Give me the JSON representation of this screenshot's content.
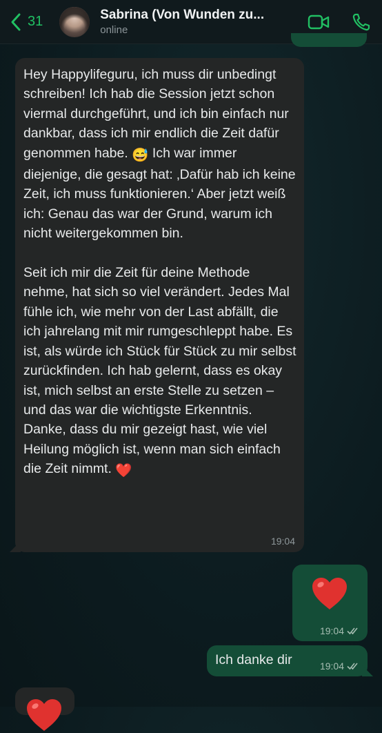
{
  "header": {
    "back_count": "31",
    "contact_name": "Sabrina (Von Wunden zu...",
    "status": "online"
  },
  "messages": {
    "incoming_long": {
      "paragraph1_a": "Hey Happylifeguru, ich muss dir unbedingt schreiben! Ich hab die Session jetzt schon viermal durchgeführt, und ich bin einfach nur dankbar, dass ich mir endlich die Zeit dafür genommen habe. ",
      "paragraph1_emoji": "😅",
      "paragraph1_b": " Ich war immer diejenige, die gesagt hat: ‚Dafür hab ich keine Zeit, ich muss funktionieren.‘ Aber jetzt weiß ich: Genau das war der Grund, warum ich nicht weitergekommen bin.",
      "paragraph2": "Seit ich mir die Zeit für deine Methode nehme, hat sich so viel verändert. Jedes Mal fühle ich, wie mehr von der Last abfällt, die ich jahrelang mit mir rumgeschleppt habe. Es ist, als würde ich Stück für Stück zu mir selbst zurückfinden. Ich hab gelernt, dass es okay ist, mich selbst an erste Stelle zu setzen – und das war die wichtigste Erkenntnis. Danke, dass du mir gezeigt hast, wie viel Heilung möglich ist, wenn man sich einfach die Zeit nimmt. ",
      "paragraph2_emoji": "❤️",
      "time": "19:04"
    },
    "outgoing_heart": {
      "time": "19:04"
    },
    "outgoing_text": {
      "text": "Ich danke dir",
      "time": "19:04"
    }
  },
  "colors": {
    "accent": "#21c063",
    "outgoing_bubble": "#144d37",
    "incoming_bubble": "#242626",
    "heart": "#e0322f"
  },
  "icons": [
    "back-chevron-icon",
    "video-call-icon",
    "phone-icon",
    "double-check-icon",
    "heart-icon"
  ]
}
